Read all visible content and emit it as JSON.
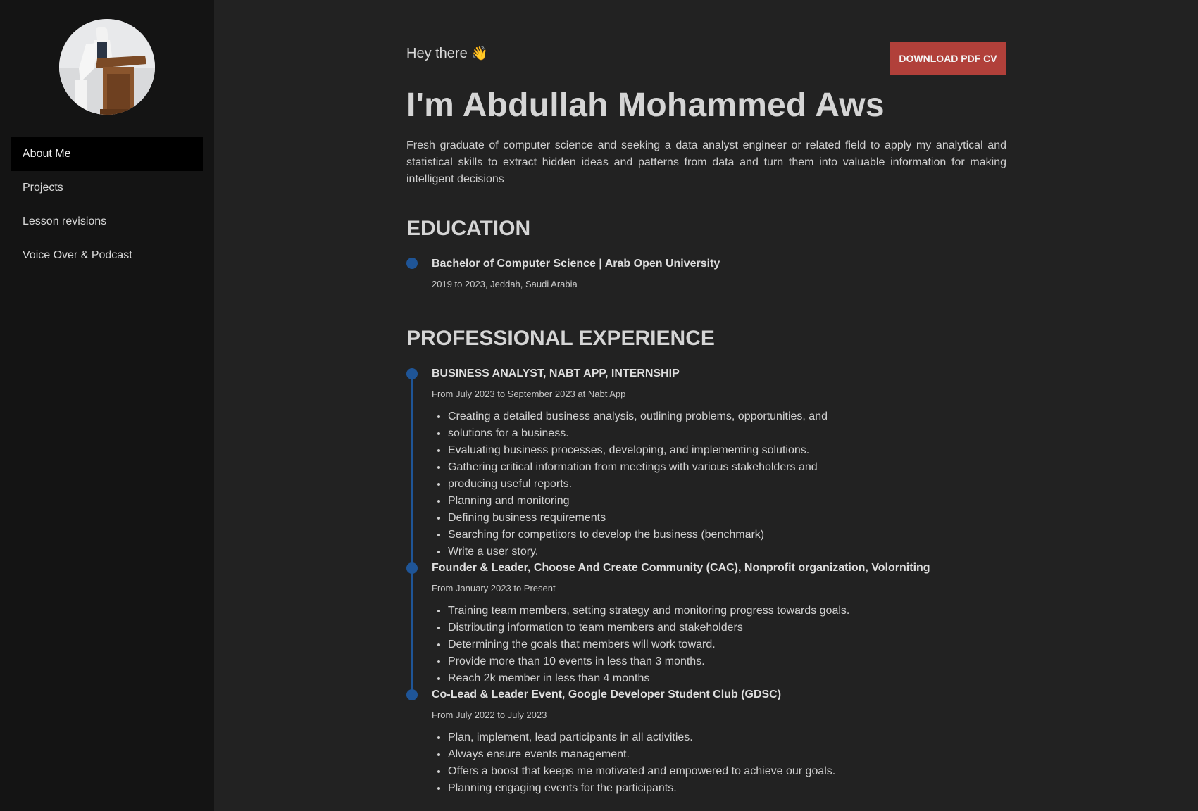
{
  "sidebar": {
    "avatar_alt": "Profile photo",
    "nav": [
      {
        "label": "About Me",
        "active": true
      },
      {
        "label": "Projects",
        "active": false
      },
      {
        "label": "Lesson revisions",
        "active": false
      },
      {
        "label": "Voice Over & Podcast",
        "active": false
      }
    ]
  },
  "header": {
    "greeting": "Hey there",
    "greeting_emoji": "👋",
    "download_label": "DOWNLOAD PDF CV",
    "name": "I'm Abdullah Mohammed Aws",
    "intro": "Fresh graduate of computer science and seeking a data analyst engineer or related field to apply my analytical and statistical skills to extract hidden ideas and patterns from data and turn them into valuable information for making intelligent decisions"
  },
  "education": {
    "title": "EDUCATION",
    "items": [
      {
        "title": "Bachelor of Computer Science | Arab Open University",
        "meta": "2019 to 2023, Jeddah, Saudi Arabia"
      }
    ]
  },
  "experience": {
    "title": "PROFESSIONAL EXPERIENCE",
    "items": [
      {
        "title": "BUSINESS ANALYST, NABT APP, INTERNSHIP",
        "meta": "From July 2023 to September 2023 at Nabt App",
        "bullets": [
          "Creating a detailed business analysis, outlining problems, opportunities, and",
          "solutions for a business.",
          "Evaluating business processes, developing, and implementing solutions.",
          "Gathering critical information from meetings with various stakeholders and",
          "producing useful reports.",
          "Planning and monitoring",
          "Defining business requirements",
          "Searching for competitors to develop the business (benchmark)",
          "Write a user story."
        ]
      },
      {
        "title": "Founder & Leader, Choose And Create Community (CAC), Nonprofit organization, Volorniting",
        "meta": "From January 2023 to Present",
        "bullets": [
          "Training team members, setting strategy and monitoring progress towards goals.",
          "Distributing information to team members and stakeholders",
          "Determining the goals that members will work toward.",
          "Provide more than 10 events in less than 3 months.",
          "Reach 2k member in less than 4 months"
        ]
      },
      {
        "title": "Co-Lead & Leader Event, Google Developer Student Club (GDSC)",
        "meta": "From July 2022 to July 2023",
        "bullets": [
          "Plan, implement, lead participants in all activities.",
          "Always ensure events management.",
          "Offers a boost that keeps me motivated and empowered to achieve our goals.",
          "Planning engaging events for the participants."
        ]
      }
    ]
  },
  "colors": {
    "background": "#222222",
    "sidebar": "#141414",
    "nav_active": "#000000",
    "accent_button": "#b1403a",
    "timeline": "#1f5597"
  }
}
